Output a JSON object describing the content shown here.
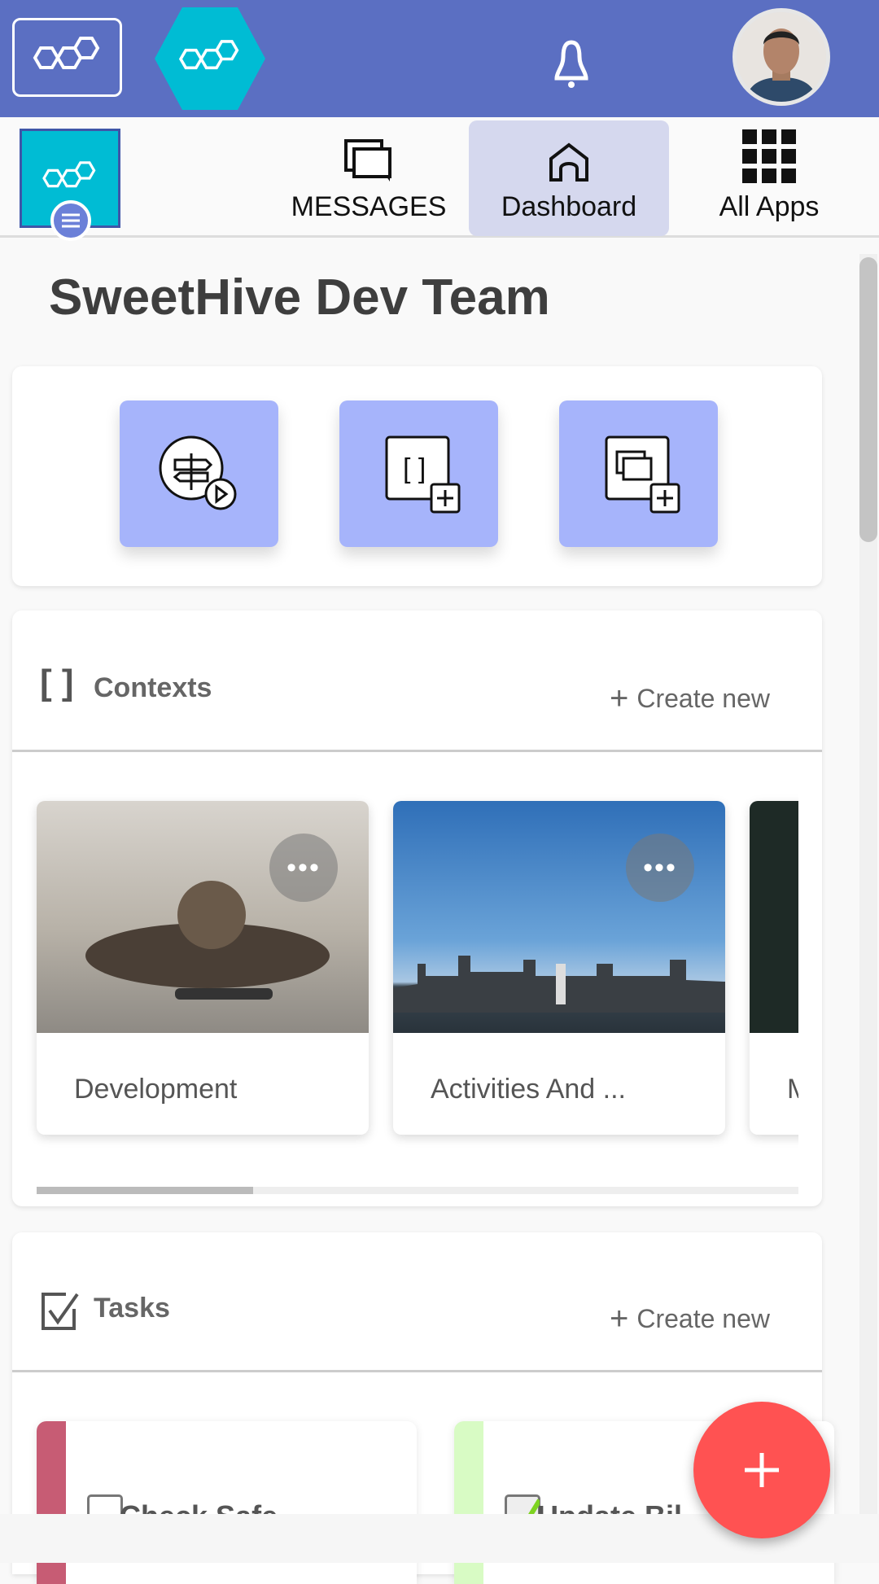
{
  "header": {
    "bell_icon": "bell-icon",
    "avatar_alt": "user avatar",
    "color": "#5b6fc2"
  },
  "nav": {
    "items": [
      {
        "label": "MESSAGES",
        "icon": "messages-icon"
      },
      {
        "label": "Dashboard",
        "icon": "home-icon",
        "active": true
      },
      {
        "label": "All Apps",
        "icon": "grid-icon"
      }
    ]
  },
  "page": {
    "title": "SweetHive Dev Team"
  },
  "quick_actions": [
    {
      "icon": "start-process-icon"
    },
    {
      "icon": "new-context-icon"
    },
    {
      "icon": "new-conversation-icon"
    }
  ],
  "contexts": {
    "title": "Contexts",
    "create_label": "Create new",
    "items": [
      {
        "label": "Development"
      },
      {
        "label": "Activities And ..."
      },
      {
        "label": "M"
      }
    ],
    "scroll_fraction": 0.28
  },
  "tasks": {
    "title": "Tasks",
    "create_label": "Create new",
    "items": [
      {
        "label": "Check Safe",
        "color": "#c75c74",
        "checked": false
      },
      {
        "label": "Update Bil",
        "color": "#d8fbc4",
        "checked": true
      }
    ]
  },
  "fab": {
    "icon": "plus-icon",
    "color": "#ff5252"
  }
}
